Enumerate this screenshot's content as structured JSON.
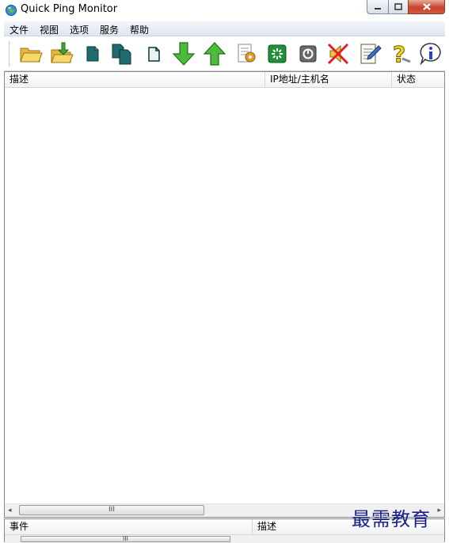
{
  "window": {
    "title": "Quick Ping Monitor",
    "minimize_label": "–",
    "maximize_label": "□",
    "close_label": "✕"
  },
  "menu": {
    "items": [
      "文件",
      "视图",
      "选项",
      "服务",
      "帮助"
    ]
  },
  "toolbar": {
    "buttons": [
      "open-folder-icon",
      "save-folder-icon",
      "new-host-icon",
      "copy-host-icon",
      "new-document-icon",
      "move-down-icon",
      "move-up-icon",
      "settings-document-icon",
      "start-monitor-icon",
      "stop-monitor-icon",
      "mute-sound-icon",
      "edit-notes-icon",
      "help-icon",
      "info-icon"
    ]
  },
  "host_list": {
    "columns": [
      "描述",
      "IP地址/主机名",
      "状态"
    ],
    "rows": [],
    "scroll_thumb_glyph": "III"
  },
  "event_log": {
    "columns": [
      "事件",
      "描述"
    ],
    "scroll_thumb_glyph": "III"
  },
  "watermark": "最需教育",
  "colors": {
    "menubar_top": "#f3f6fb",
    "close_button": "#c7432b",
    "watermark": "#1a1f8a"
  }
}
